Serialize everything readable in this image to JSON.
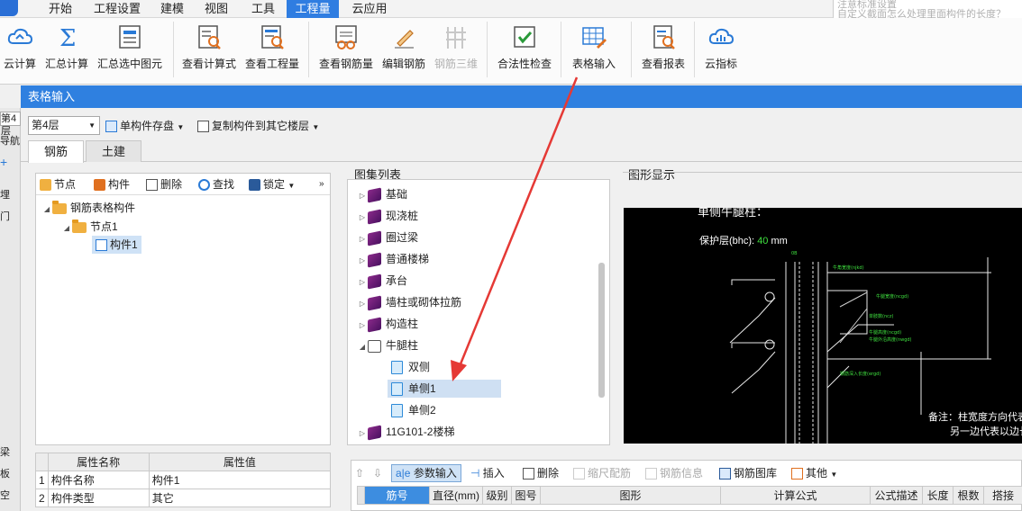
{
  "menu": {
    "items": [
      "开始",
      "工程设置",
      "建模",
      "视图",
      "工具",
      "工程量",
      "云应用"
    ],
    "active_index": 5,
    "right_text": [
      "注意标准设置",
      "自定义截面怎么处理里面构件的长度？"
    ]
  },
  "ribbon": {
    "buttons": [
      "云计算",
      "汇总计算",
      "汇总选中图元",
      "查看计算式",
      "查看工程量",
      "查看钢筋量",
      "编辑钢筋",
      "钢筋三维",
      "合法性检查",
      "表格输入",
      "查看报表",
      "云指标"
    ],
    "disabled": [
      "钢筋三维"
    ]
  },
  "left_strip": {
    "items": [
      "第4层",
      "导航",
      "埋",
      "门",
      "梁",
      "板",
      "空"
    ]
  },
  "dialog": {
    "title": "表格输入",
    "floor_select": "第4层",
    "toolbar": {
      "save_single": "单构件存盘",
      "copy_to_floor": "复制构件到其它楼层"
    },
    "tabs": [
      "钢筋",
      "土建"
    ],
    "active_tab": 0,
    "tree_toolbar": [
      "节点",
      "构件",
      "删除",
      "查找",
      "锁定"
    ],
    "tree": {
      "root": "钢筋表格构件",
      "node": "节点1",
      "component": "构件1"
    },
    "props": {
      "headers": [
        "属性名称",
        "属性值"
      ],
      "rows": [
        {
          "num": "1",
          "name": "构件名称",
          "value": "构件1"
        },
        {
          "num": "2",
          "name": "构件类型",
          "value": "其它"
        }
      ]
    },
    "atlas": {
      "title": "图集列表",
      "items": [
        "基础",
        "现浇桩",
        "圈过梁",
        "普通楼梯",
        "承台",
        "墙柱或砌体拉筋",
        "构造柱",
        "牛腿柱"
      ],
      "children": [
        "双侧",
        "单侧1",
        "单侧2"
      ],
      "after": "11G101-2楼梯",
      "selected": "单侧1"
    },
    "figure": {
      "title": "图形显示",
      "heading": "单侧牛腿柱：",
      "cover_label": "保护层(bhc):",
      "cover_value": "40",
      "cover_unit": "mm",
      "note1": "备注：柱宽度方向代表",
      "note2": "另一边代表以边长",
      "small_labels": [
        "牛腿宽度(ncgd)",
        "牛腿高度(ncgd)",
        "钢筋深入长度(ergd)",
        "牛角宽度(njkd)",
        "单肢数(ncz)",
        "牛腿外沿高度(nwgd)"
      ]
    },
    "rebar_toolbar": [
      "参数输入",
      "插入",
      "删除",
      "缩尺配筋",
      "钢筋信息",
      "钢筋图库",
      "其他"
    ],
    "rebar_table_headers": [
      "筋号",
      "直径(mm)",
      "级别",
      "图号",
      "图形",
      "计算公式",
      "公式描述",
      "长度",
      "根数",
      "搭接"
    ]
  }
}
